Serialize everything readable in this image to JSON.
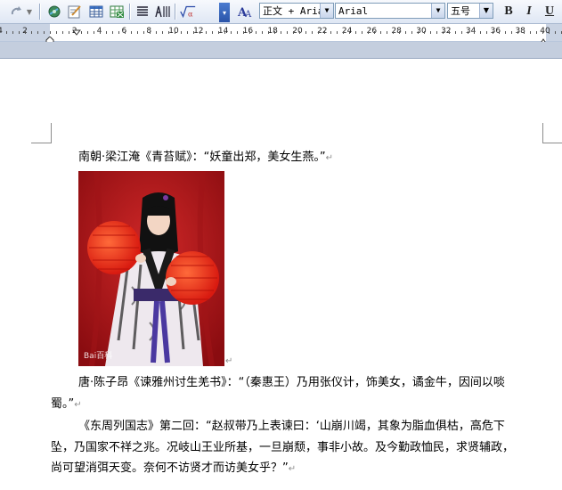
{
  "toolbar": {
    "style_value": "正文 + Aria",
    "font_value": "Arial",
    "size_value": "五号",
    "bold_label": "B",
    "italic_label": "I",
    "underline_label": "U",
    "icons": [
      "redo-icon",
      "hyperlink-icon",
      "drawing-icon",
      "table-icon",
      "excel-icon",
      "columns-icon",
      "text-direction-icon",
      "equation-icon",
      "font-style-icon"
    ]
  },
  "ruler": {
    "numbers": [
      "4",
      "2",
      "2",
      "4",
      "6",
      "8",
      "10",
      "12",
      "14",
      "16",
      "18",
      "20",
      "22",
      "24",
      "26",
      "28",
      "30",
      "32",
      "34",
      "36",
      "38",
      "40"
    ]
  },
  "document": {
    "p1": "南朝·梁江淹《青苔赋》：“妖童出郑，美女生燕。”",
    "photo_watermark": "Bai百科",
    "p2_line1": "唐·陈子昂《谏雅州讨生羌书》：“（秦惠王）乃用张仪计，饰美女，谲金牛，因间以啖",
    "p2_line2": "蜀。”",
    "p3_line1": "《东周列国志》第二回：“赵叔带乃上表谏曰：‘山崩川竭，其象为脂血俱枯，高危下",
    "p3_line2": "坠，乃国家不祥之兆。况岐山王业所基，一旦崩颓，事非小故。及今勤政恤民，求贤辅政，",
    "p3_line3": "尚可望消弭天变。奈何不访贤才而访美女乎？”",
    "para_mark": "↵"
  }
}
